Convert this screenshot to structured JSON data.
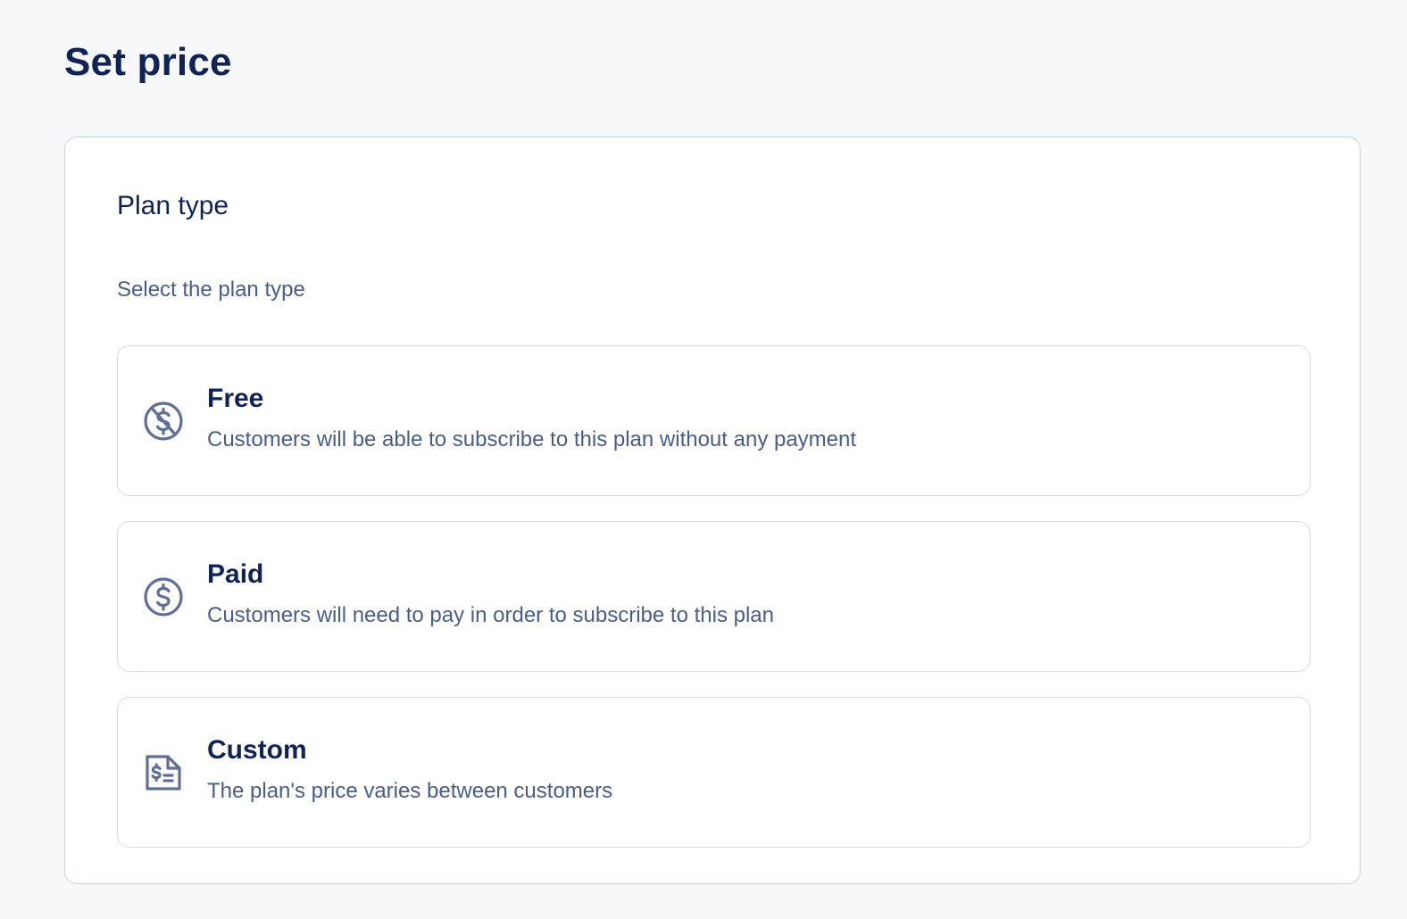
{
  "page": {
    "title": "Set price"
  },
  "plan_type": {
    "title": "Plan type",
    "subtitle": "Select the plan type",
    "options": [
      {
        "icon": "dollar-slash-icon",
        "label": "Free",
        "description": "Customers will be able to subscribe to this plan without any payment"
      },
      {
        "icon": "dollar-circle-icon",
        "label": "Paid",
        "description": "Customers will need to pay in order to subscribe to this plan"
      },
      {
        "icon": "custom-price-document-icon",
        "label": "Custom",
        "description": "The plan's price varies between customers"
      }
    ]
  },
  "colors": {
    "heading": "#0f2356",
    "muted_text": "#4a5d85",
    "icon": "#5f6f95",
    "background": "#f7f8fa",
    "card": "#ffffff",
    "border": "#d6dbe6"
  }
}
